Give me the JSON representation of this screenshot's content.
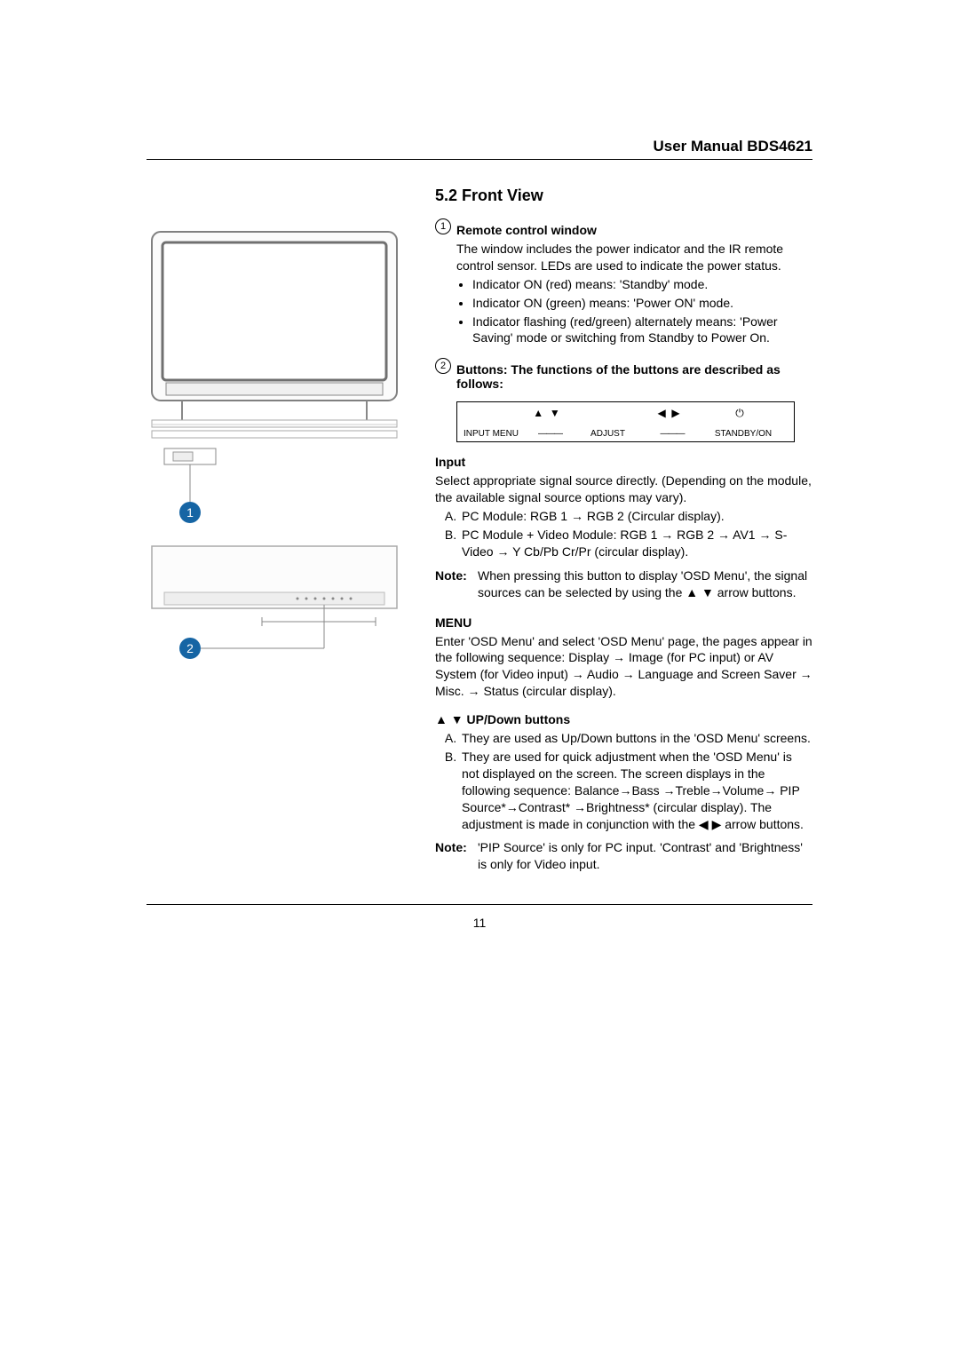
{
  "header": {
    "title": "User Manual BDS4621"
  },
  "section": {
    "number_title": "5.2 Front View",
    "item1": {
      "num": "1",
      "heading": "Remote control window",
      "intro": "The window includes the power indicator and the IR remote control sensor. LEDs are used to indicate the power status.",
      "bullets": [
        "Indicator ON (red) means: 'Standby' mode.",
        "Indicator ON (green) means: 'Power ON' mode.",
        "Indicator flashing (red/green) alternately means: 'Power Saving' mode or switching from Standby to Power On."
      ]
    },
    "item2": {
      "num": "2",
      "heading": "Buttons: The functions of the buttons are described as follows:"
    },
    "button_diagram": {
      "input": "INPUT",
      "menu": "MENU",
      "adjust": "ADJUST",
      "standby": "STANDBY/ON"
    },
    "input_section": {
      "heading": "Input",
      "intro": "Select appropriate signal source directly. (Depending on the module, the available signal source options may vary).",
      "list": [
        "PC Module: RGB 1 → RGB 2 (Circular display).",
        "PC Module + Video Module: RGB 1 → RGB 2 → AV1 → S-Video → Y Cb/Pb Cr/Pr (circular display)."
      ],
      "note_label": "Note:",
      "note": "When pressing this button to display 'OSD Menu', the signal sources can be selected by using the ▲ ▼ arrow buttons."
    },
    "menu_section": {
      "heading": "MENU",
      "text": "Enter 'OSD Menu' and select 'OSD Menu' page, the pages appear in the following sequence: Display → Image (for PC input) or AV System (for Video input) → Audio → Language and Screen Saver → Misc. → Status (circular display)."
    },
    "updown_section": {
      "heading": "▲ ▼ UP/Down buttons",
      "list": [
        "They are used as Up/Down buttons in the 'OSD Menu' screens.",
        "They are used for quick adjustment when the 'OSD Menu' is not displayed on the screen. The screen displays in the following sequence: Balance→Bass →Treble→Volume→ PIP Source*→Contrast* →Brightness* (circular display). The adjustment is made in conjunction with the ◀ ▶ arrow buttons."
      ],
      "note_label": "Note:",
      "note": "'PIP Source' is only for PC input. 'Contrast' and 'Brightness' is only for Video input."
    }
  },
  "figure_labels": {
    "callout1": "1",
    "callout2": "2"
  },
  "page_number": "11"
}
